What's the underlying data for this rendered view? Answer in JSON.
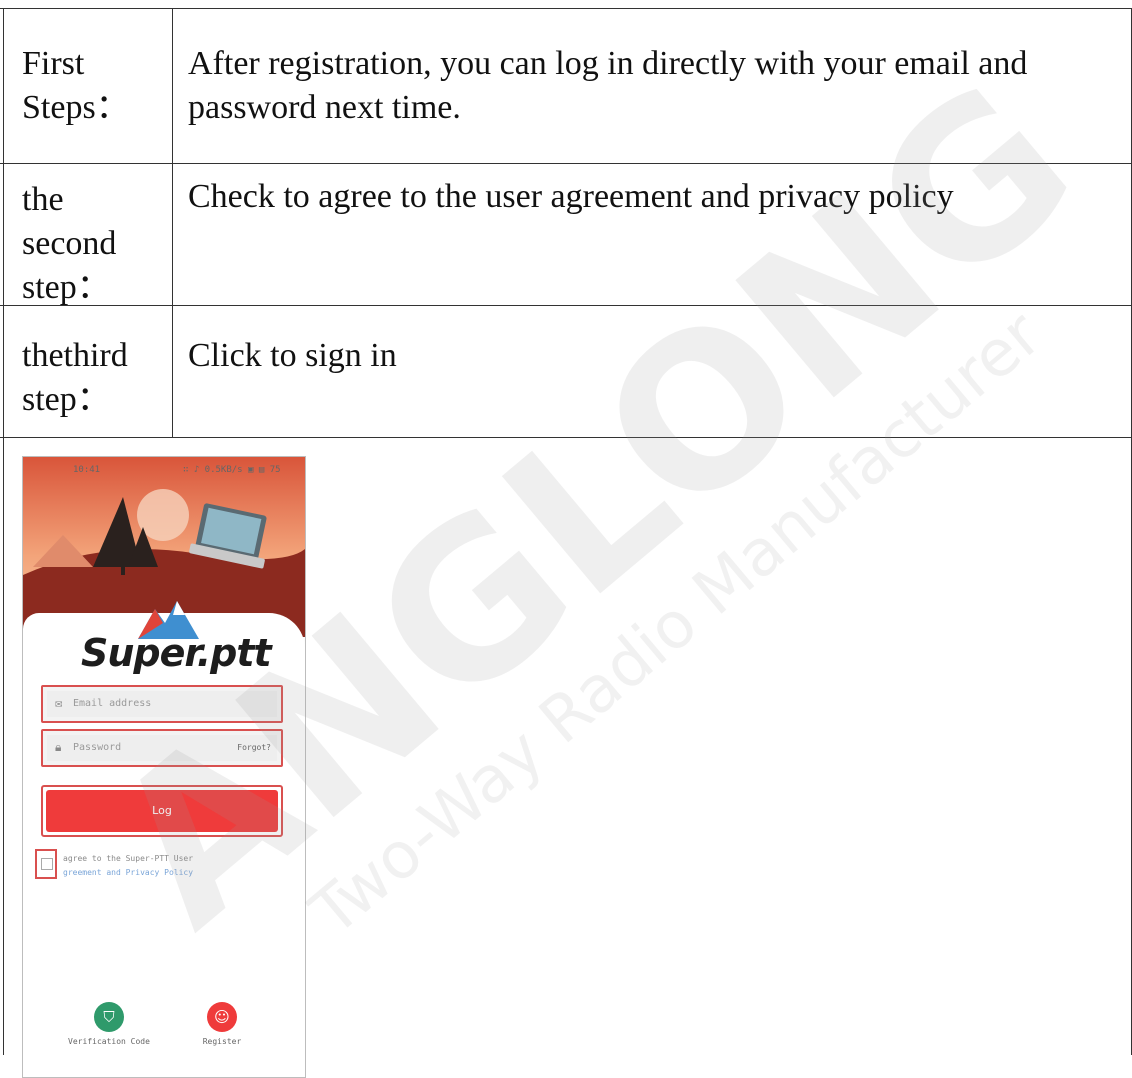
{
  "table": {
    "rows": [
      {
        "label_lines": [
          "First",
          "Steps："
        ],
        "content_lines": [
          "After registration, you can log in directly with your email and",
          "password next time."
        ]
      },
      {
        "label_lines": [
          "the",
          "second",
          "step："
        ],
        "content_lines": [
          "Check to agree to the user agreement and privacy policy"
        ]
      },
      {
        "label_lines": [
          "thethird",
          "step："
        ],
        "content_lines": [
          "Click to sign in"
        ]
      }
    ]
  },
  "watermark": {
    "brand": "ANGLONG",
    "tagline": "Two-Way Radio Manufacturer"
  },
  "phone": {
    "status_time": "10:41",
    "status_right": "∷ ♪ 0.5KB/s ▣ ▤ 75",
    "logo": "Super.ptt",
    "email_placeholder": "Email address",
    "password_placeholder": "Password",
    "forgot_label": "Forgot?",
    "login_label": "Log",
    "agree_prefix": "agree to the Super-PTT User",
    "agree_suffix_link": "greement and Privacy Policy",
    "verification_label": "Verification Code",
    "register_label": "Register",
    "accent": "#ef3b3b",
    "highlight": "#d9504f",
    "icons": {
      "email": "mail-icon",
      "password": "lock-icon",
      "verification": "shield-icon",
      "register": "user-icon"
    }
  }
}
